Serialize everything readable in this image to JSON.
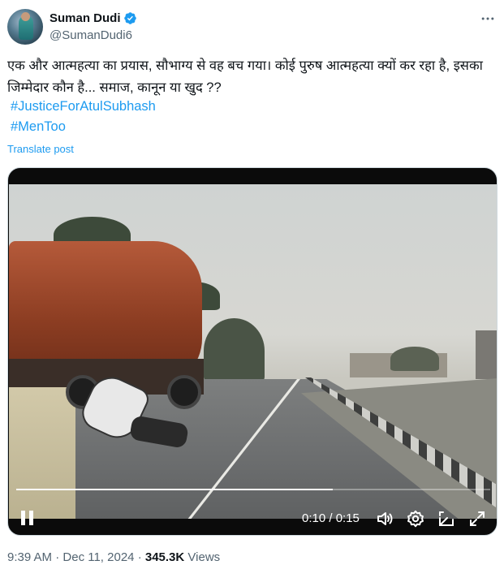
{
  "author": {
    "display_name": "Suman Dudi",
    "handle": "@SumanDudi6",
    "verified": true,
    "avatar": "avatar-photo"
  },
  "tweet": {
    "text": "एक और आत्महत्या का प्रयास, सौभाग्य से वह बच गया। कोई पुरुष  आत्महत्या क्यों कर रहा है, इसका जिम्मेदार कौन है... समाज, कानून या  खुद ??",
    "hashtags": [
      "#JusticeForAtulSubhash",
      "#MenToo"
    ],
    "translate_label": "Translate post"
  },
  "video": {
    "current_time": "0:10",
    "duration": "0:15",
    "time_display": "0:10 / 0:15",
    "progress": 0.667,
    "icons": {
      "pause": "pause-icon",
      "volume": "volume-icon",
      "settings": "settings-gear-icon",
      "pip": "picture-in-picture-icon",
      "fullscreen": "fullscreen-icon"
    }
  },
  "meta": {
    "time": "9:39 AM",
    "separator": "·",
    "date": "Dec 11, 2024",
    "views_count": "345.3K",
    "views_label": "Views"
  },
  "colors": {
    "accent": "#1d9bf0",
    "text": "#0f1419",
    "secondary": "#536471"
  }
}
